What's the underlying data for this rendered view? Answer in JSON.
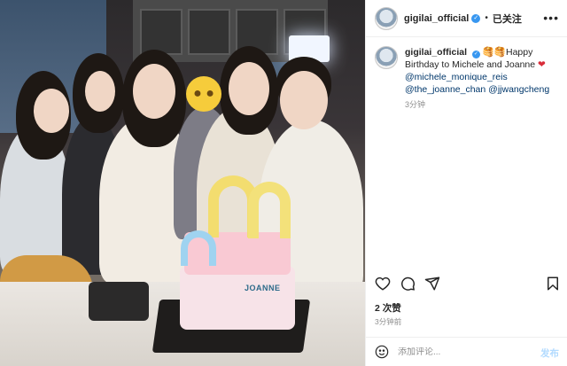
{
  "post_photo": {
    "alt": "",
    "cake_letter": "JOANNE"
  },
  "header": {
    "username": "gigilai_official",
    "verified": true,
    "follow_state": "已关注"
  },
  "caption": {
    "username": "gigilai_official",
    "text": " 🥞🥞Happy Birthday to Michele and Joanne ",
    "mentions": [
      "@michele_monique_reis",
      "@the_joanne_chan",
      "@jjwangcheng"
    ],
    "timestamp": "3分钟"
  },
  "actions": {
    "like_icon": "heart-icon",
    "comment_icon": "comment-icon",
    "share_icon": "share-icon",
    "save_icon": "bookmark-icon"
  },
  "likes_text": "2 次赞",
  "post_time": "3分钟前",
  "comment": {
    "placeholder": "添加评论...",
    "post_label": "发布"
  },
  "colors": {
    "link": "#00376b",
    "verified": "#3897f0",
    "muted": "#8e8e8e",
    "post_button_disabled": "#b3dbff"
  }
}
